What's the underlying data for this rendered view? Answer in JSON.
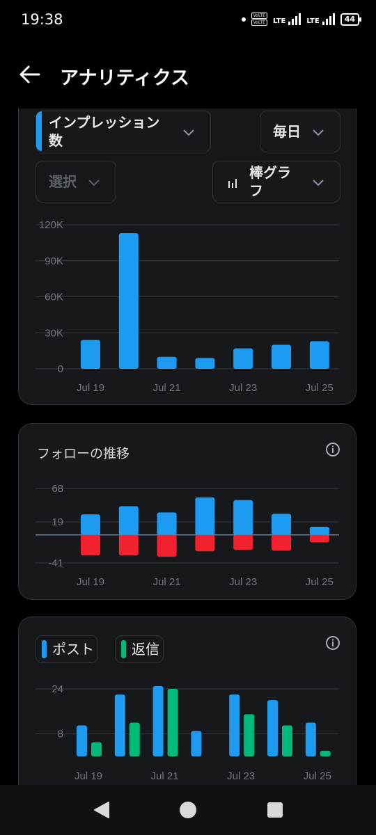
{
  "status": {
    "time": "19:38",
    "volte": [
      "VoLTE",
      "VoLTE"
    ],
    "lte1": "LTE",
    "lte2": "LTE",
    "battery": "44"
  },
  "appbar": {
    "title": "アナリティクス"
  },
  "colors": {
    "blue": "#1d9bf0",
    "red": "#f4212e",
    "green": "#00ba7c",
    "card": "#16181c",
    "grid": "#2f3336"
  },
  "impressions": {
    "metric_label": "インプレッション数",
    "period_label": "毎日",
    "select_label": "選択",
    "chart_type_label": "棒グラフ",
    "chart_data": {
      "type": "bar",
      "categories": [
        "Jul 19",
        "Jul 20",
        "Jul 21",
        "Jul 22",
        "Jul 23",
        "Jul 24",
        "Jul 25"
      ],
      "values": [
        24000,
        113000,
        10000,
        9000,
        17000,
        20000,
        23000
      ],
      "yticks": [
        0,
        30000,
        60000,
        90000,
        120000
      ],
      "ytick_labels": [
        "0",
        "30K",
        "60K",
        "90K",
        "120K"
      ],
      "xtick_labels": [
        "Jul 19",
        "Jul 21",
        "Jul 23",
        "Jul 25"
      ],
      "ylim": [
        0,
        120000
      ]
    }
  },
  "follows": {
    "title": "フォローの推移",
    "chart_data": {
      "type": "bar",
      "categories": [
        "Jul 19",
        "Jul 20",
        "Jul 21",
        "Jul 22",
        "Jul 23",
        "Jul 24",
        "Jul 25"
      ],
      "series": [
        {
          "values": [
            30,
            42,
            33,
            55,
            51,
            31,
            12
          ]
        },
        {
          "values": [
            -30,
            -30,
            -32,
            -24,
            -22,
            -23,
            -11
          ]
        }
      ],
      "yticks": [
        -41,
        19,
        68
      ],
      "ytick_labels": [
        "-41",
        "19",
        "68"
      ],
      "xtick_labels": [
        "Jul 19",
        "Jul 21",
        "Jul 23",
        "Jul 25"
      ],
      "ylim": [
        -41,
        68
      ]
    }
  },
  "posts": {
    "legend": [
      "ポスト",
      "返信"
    ],
    "chart_data": {
      "type": "bar",
      "categories": [
        "Jul 19",
        "Jul 20",
        "Jul 21",
        "Jul 22",
        "Jul 23",
        "Jul 24",
        "Jul 25"
      ],
      "series": [
        {
          "name": "ポスト",
          "values": [
            11,
            22,
            25,
            9,
            22,
            20,
            12
          ]
        },
        {
          "name": "返信",
          "values": [
            5,
            12,
            24,
            0,
            15,
            11,
            2
          ]
        }
      ],
      "yticks": [
        8,
        24
      ],
      "ytick_labels": [
        "8",
        "24"
      ],
      "xtick_labels": [
        "Jul 19",
        "Jul 21",
        "Jul 23",
        "Jul 25"
      ],
      "ylim": [
        0,
        24
      ]
    }
  },
  "nav": {
    "back_icon": "triangle-back-icon",
    "home_icon": "circle-home-icon",
    "recents_icon": "square-recents-icon"
  }
}
